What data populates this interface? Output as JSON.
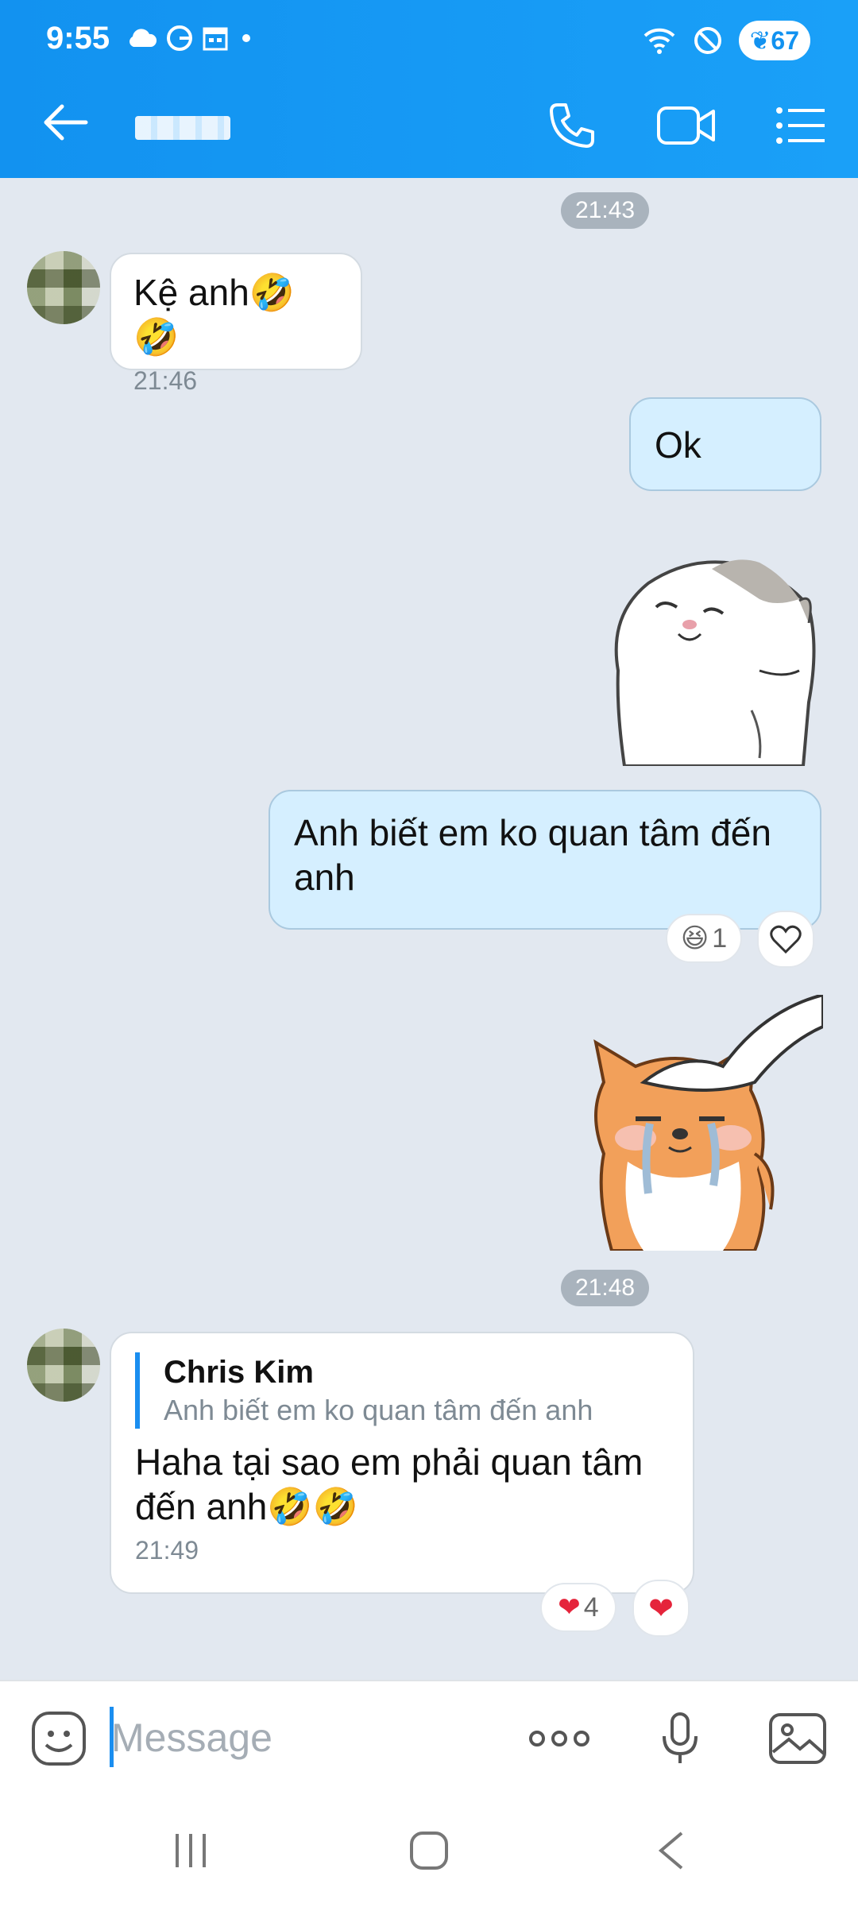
{
  "status": {
    "time": "9:55",
    "battery": "67"
  },
  "header": {
    "contact_name": ""
  },
  "messages": {
    "ts1": "21:43",
    "m1_text": "Kệ anh🤣🤣",
    "m1_time": "21:46",
    "m2_text": "Ok",
    "m4_text": "Anh biết em ko quan tâm đến anh",
    "m4_react_count": "1",
    "ts2": "21:48",
    "m6_reply_name": "Chris Kim",
    "m6_reply_text": "Anh biết em ko quan tâm đến anh",
    "m6_text": "Haha tại sao em phải quan tâm đến anh🤣🤣",
    "m6_time": "21:49",
    "m6_react_count": "4"
  },
  "input": {
    "placeholder": "Message"
  },
  "colors": {
    "header": "#1292f0",
    "accent": "#1a8ef0",
    "bubble_out": "#d5efff",
    "chat_bg": "#e2e8f0"
  }
}
